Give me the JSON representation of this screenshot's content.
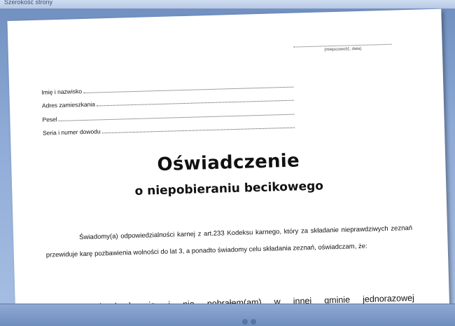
{
  "window": {
    "caption": "Szerokość strony"
  },
  "document": {
    "place_date_hint": "(miejscowość, data)",
    "fields": [
      "Imię i nazwisko",
      "Adres zamieszkania",
      "Pesel",
      "Seria i numer dowodu"
    ],
    "title": "Oświadczenie",
    "subtitle": "o niepobieraniu becikowego",
    "paragraph": "Świadomy(a) odpowiedzialności karnej z art.233 Kodeksu karnego, który za składanie nieprawdziwych zeznań przewiduje karę pozbawienia wolności do lat 3, a ponadto świadomy celu składania zeznań, oświadczam, że:",
    "statement": "Nie ubiegałem(am) się i nie pobrałem(am) w innej gminie jednorazowej"
  }
}
